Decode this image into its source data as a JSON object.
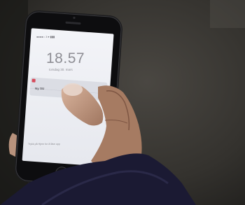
{
  "lockscreen": {
    "status_bar": "●●●●○ 3  ▾        ▮▮▮",
    "time": "18.57",
    "date": "torsdag 30. mars",
    "notification": "Ny SU",
    "slide_hint": "Trykk på Hjem for å låse opp"
  },
  "colors": {
    "screen": "#eef0f5",
    "phone_frame": "#1c1c1e",
    "phone_bezel": "#0d0d0f",
    "jacket": "#1b1a33",
    "floor": "#2e2c29"
  }
}
